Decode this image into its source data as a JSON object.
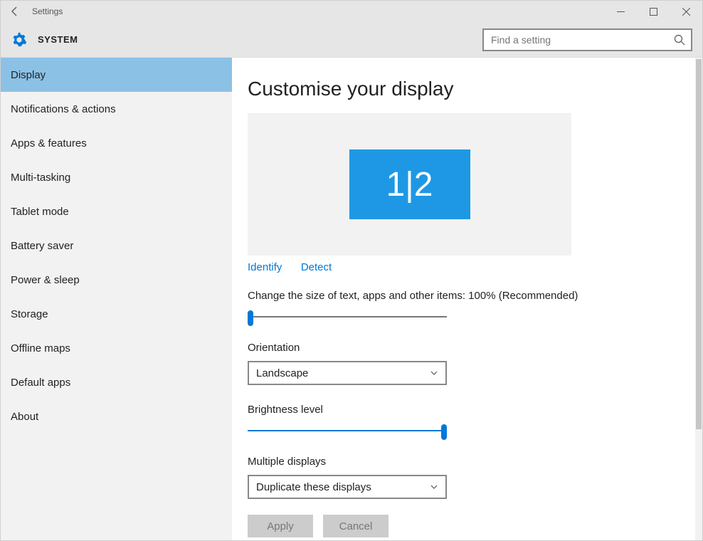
{
  "window": {
    "title": "Settings"
  },
  "header": {
    "system_label": "SYSTEM",
    "search_placeholder": "Find a setting"
  },
  "sidebar": {
    "items": [
      {
        "label": "Display",
        "selected": true
      },
      {
        "label": "Notifications & actions"
      },
      {
        "label": "Apps & features"
      },
      {
        "label": "Multi-tasking"
      },
      {
        "label": "Tablet mode"
      },
      {
        "label": "Battery saver"
      },
      {
        "label": "Power & sleep"
      },
      {
        "label": "Storage"
      },
      {
        "label": "Offline maps"
      },
      {
        "label": "Default apps"
      },
      {
        "label": "About"
      }
    ]
  },
  "main": {
    "heading": "Customise your display",
    "monitor_label": "1|2",
    "identify_label": "Identify",
    "detect_label": "Detect",
    "scale_label": "Change the size of text, apps and other items: 100% (Recommended)",
    "scale_percent": 0,
    "orientation_label": "Orientation",
    "orientation_value": "Landscape",
    "brightness_label": "Brightness level",
    "brightness_percent": 100,
    "multiple_label": "Multiple displays",
    "multiple_value": "Duplicate these displays",
    "apply_label": "Apply",
    "cancel_label": "Cancel"
  }
}
